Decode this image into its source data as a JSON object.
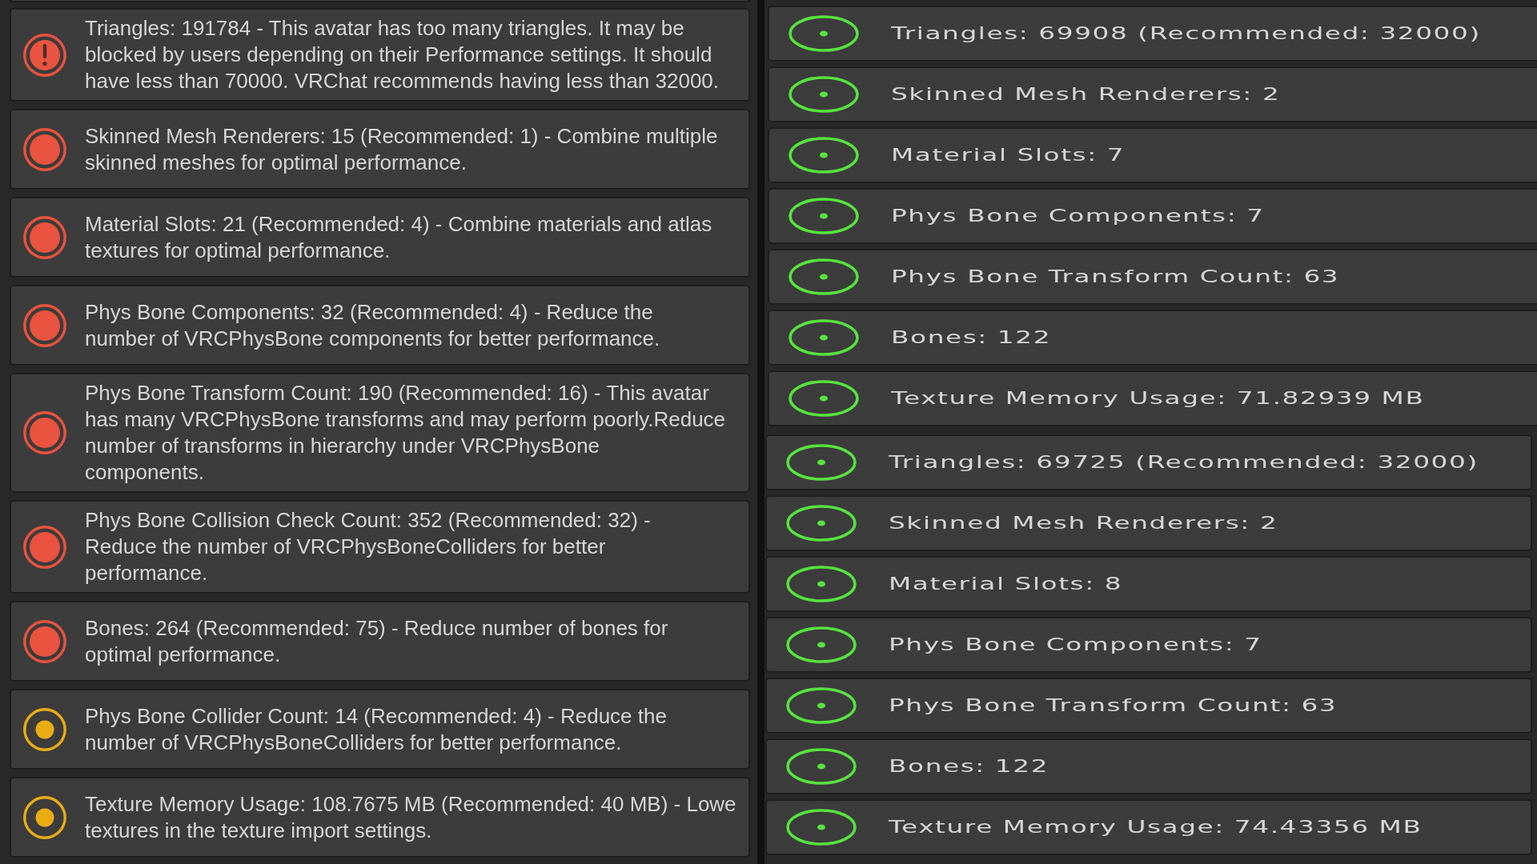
{
  "left_panel": {
    "issues": [
      {
        "kind": "critical",
        "lines": [
          "Triangles: 191784 - This avatar has too many triangles. It may be",
          "blocked by users depending on their Performance settings. It should",
          "have less than 70000. VRChat recommends having less than 32000."
        ]
      },
      {
        "kind": "poor",
        "lines": [
          "Skinned Mesh Renderers: 15 (Recommended: 1) - Combine multiple",
          "skinned meshes for optimal performance."
        ]
      },
      {
        "kind": "poor",
        "lines": [
          "Material Slots: 21 (Recommended: 4) - Combine materials and atlas",
          "textures for optimal performance."
        ]
      },
      {
        "kind": "poor",
        "lines": [
          "Phys Bone Components: 32 (Recommended: 4) - Reduce the",
          "number of VRCPhysBone components for better performance."
        ]
      },
      {
        "kind": "poor",
        "lines": [
          "Phys Bone Transform Count: 190 (Recommended: 16) - This avatar",
          "has many VRCPhysBone transforms and may perform poorly.Reduce",
          "number of transforms in hierarchy under VRCPhysBone",
          "components."
        ]
      },
      {
        "kind": "poor",
        "lines": [
          "Phys Bone Collision Check Count: 352 (Recommended: 32) -",
          "Reduce the number of VRCPhysBoneColliders for better",
          "performance."
        ]
      },
      {
        "kind": "poor",
        "lines": [
          "Bones: 264 (Recommended: 75) - Reduce number of bones for",
          "optimal performance."
        ]
      },
      {
        "kind": "medium",
        "lines": [
          "Phys Bone Collider Count: 14 (Recommended: 4) - Reduce the",
          "number of VRCPhysBoneColliders for better performance."
        ]
      },
      {
        "kind": "medium",
        "lines": [
          "Texture Memory Usage: 108.7675 MB (Recommended: 40 MB) - Lowe",
          "textures in the texture import settings."
        ]
      }
    ]
  },
  "right_panel": {
    "sections": [
      {
        "rows": [
          {
            "kind": "good",
            "text": "Triangles: 69908 (Recommended: 32000)"
          },
          {
            "kind": "good",
            "text": "Skinned Mesh Renderers: 2"
          },
          {
            "kind": "good",
            "text": "Material Slots: 7"
          },
          {
            "kind": "good",
            "text": "Phys Bone Components: 7"
          },
          {
            "kind": "good",
            "text": "Phys Bone Transform Count: 63"
          },
          {
            "kind": "good",
            "text": "Bones: 122"
          },
          {
            "kind": "good",
            "text": "Texture Memory Usage: 71.82939 MB"
          }
        ]
      },
      {
        "rows": [
          {
            "kind": "good",
            "text": "Triangles: 69725 (Recommended: 32000)"
          },
          {
            "kind": "good",
            "text": "Skinned Mesh Renderers: 2"
          },
          {
            "kind": "good",
            "text": "Material Slots: 8"
          },
          {
            "kind": "good",
            "text": "Phys Bone Components: 7"
          },
          {
            "kind": "good",
            "text": "Phys Bone Transform Count: 63"
          },
          {
            "kind": "good",
            "text": "Bones: 122"
          },
          {
            "kind": "good",
            "text": "Texture Memory Usage: 74.43356 MB"
          }
        ]
      }
    ]
  }
}
